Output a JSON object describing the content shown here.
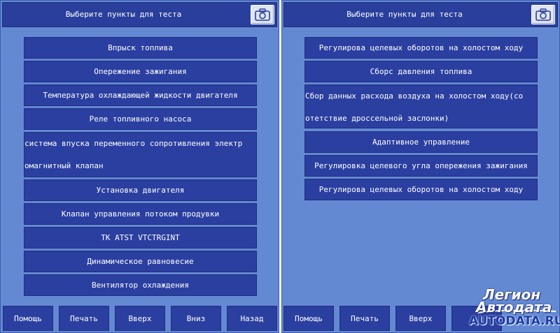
{
  "colors": {
    "panel_background": "#6489d3",
    "button_background": "#2b3fa0",
    "text": "#ffffff"
  },
  "left_panel": {
    "header_title": "Выберите пункты для теста",
    "camera_icon": "camera-icon",
    "items": [
      {
        "label": "Впрыск топлива"
      },
      {
        "label": "Опережение зажигания"
      },
      {
        "label": "Температура охлаждающей жидкости двигателя"
      },
      {
        "label": "Реле топливного насоса"
      },
      {
        "label_line1": "система впуска переменного сопротивления электр",
        "label_line2": " омагнитный клапан"
      },
      {
        "label": "Установка двигателя"
      },
      {
        "label": "Клапан управления потоком продувки"
      },
      {
        "label": "TK ATST VTCTRGINT"
      },
      {
        "label": "Динамическое равновесие"
      },
      {
        "label": "Вентилятор охлаждения"
      }
    ],
    "footer": [
      "Помощь",
      "Печать",
      "Вверх",
      "Вниз",
      "Назад"
    ]
  },
  "right_panel": {
    "header_title": "Выберите пункты для теста",
    "camera_icon": "camera-icon",
    "items": [
      {
        "label": "Регулирова целевых оборотов на холостом ходу"
      },
      {
        "label": "Сборс давления топлива"
      },
      {
        "label_line1": "Сбор данных расхода воздуха на холостом ходу(со",
        "label_line2": " отетствие дроссельной заслонки)"
      },
      {
        "label": "Адаптивное управление"
      },
      {
        "label": "Регулировка целевого угла опережения зажигания"
      },
      {
        "label": "Регулирова целевых оборотов на холостом ходу"
      }
    ],
    "footer": [
      "Помощь",
      "Печать",
      "Вверх"
    ]
  },
  "watermark": {
    "line1": "Легион",
    "line2": "Автодата",
    "line3": "AUTODATA.RU"
  }
}
